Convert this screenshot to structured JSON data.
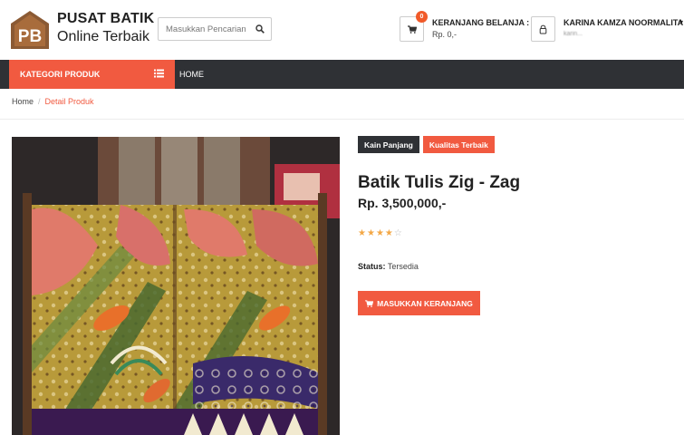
{
  "brand": {
    "initials": "PB",
    "title": "PUSAT BATIK",
    "subtitle": "Online Terbaik"
  },
  "search": {
    "placeholder": "Masukkan Pencarian .."
  },
  "cart": {
    "badge": "0",
    "title": "KERANJANG BELANJA :",
    "total": "Rp. 0,-"
  },
  "user": {
    "name": "KARINA KAMZA NOORMALITA",
    "email": "karin..."
  },
  "nav": {
    "category_label": "KATEGORI PRODUK",
    "home_label": "HOME"
  },
  "breadcrumb": {
    "home": "Home",
    "separator": "/",
    "current": "Detail Produk"
  },
  "product": {
    "tags": [
      "Kain Panjang",
      "Kualitas Terbaik"
    ],
    "title": "Batik Tulis Zig - Zag",
    "price": "Rp. 3,500,000,-",
    "rating": 4,
    "rating_max": 5,
    "status_label": "Status:",
    "status_value": "Tersedia",
    "add_to_cart_label": "MASUKKAN KERANJANG"
  },
  "icons": {
    "search": "search-icon",
    "cart": "cart-icon",
    "user": "user-icon",
    "menu": "list-icon"
  },
  "colors": {
    "accent": "#f15a40",
    "dark": "#2f3135",
    "star": "#f3a847"
  }
}
